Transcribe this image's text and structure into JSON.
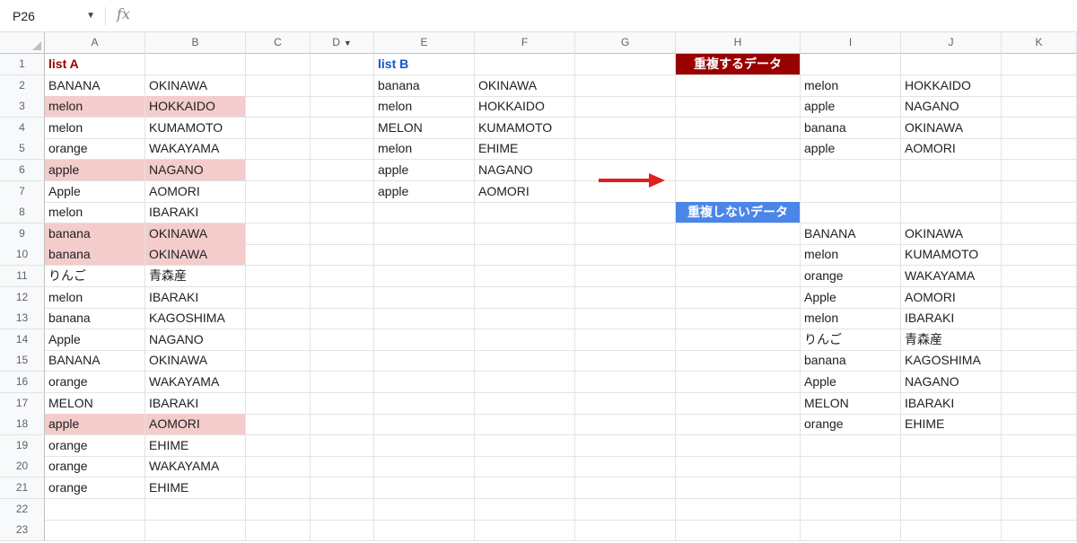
{
  "formula_bar": {
    "name_box": "P26",
    "fx_label": "fx"
  },
  "columns": [
    "A",
    "B",
    "C",
    "D",
    "E",
    "F",
    "G",
    "H",
    "I",
    "J",
    "K"
  ],
  "rows": [
    "1",
    "2",
    "3",
    "4",
    "5",
    "6",
    "7",
    "8",
    "9",
    "10",
    "11",
    "12",
    "13",
    "14",
    "15",
    "16",
    "17",
    "18",
    "19",
    "20",
    "21",
    "22",
    "23"
  ],
  "list_a": {
    "title": "list A",
    "rows": [
      [
        "BANANA",
        "OKINAWA"
      ],
      [
        "melon",
        "HOKKAIDO"
      ],
      [
        "melon",
        "KUMAMOTO"
      ],
      [
        "orange",
        "WAKAYAMA"
      ],
      [
        "apple",
        "NAGANO"
      ],
      [
        "Apple",
        "AOMORI"
      ],
      [
        "melon",
        "IBARAKI"
      ],
      [
        "banana",
        "OKINAWA"
      ],
      [
        "banana",
        "OKINAWA"
      ],
      [
        "りんご",
        "青森産"
      ],
      [
        "melon",
        "IBARAKI"
      ],
      [
        "banana",
        "KAGOSHIMA"
      ],
      [
        "Apple",
        "NAGANO"
      ],
      [
        "BANANA",
        "OKINAWA"
      ],
      [
        "orange",
        "WAKAYAMA"
      ],
      [
        "MELON",
        "IBARAKI"
      ],
      [
        "apple",
        "AOMORI"
      ],
      [
        "orange",
        "EHIME"
      ],
      [
        "orange",
        "WAKAYAMA"
      ],
      [
        "orange",
        "EHIME"
      ]
    ],
    "highlight_color": "#f4cccc"
  },
  "list_b": {
    "title": "list B",
    "rows": [
      [
        "banana",
        "OKINAWA"
      ],
      [
        "melon",
        "HOKKAIDO"
      ],
      [
        "MELON",
        "KUMAMOTO"
      ],
      [
        "melon",
        "EHIME"
      ],
      [
        "apple",
        "NAGANO"
      ],
      [
        "apple",
        "AOMORI"
      ]
    ]
  },
  "dup_label": "重複するデータ",
  "dup_color": "#990000",
  "duplicates": [
    [
      "melon",
      "HOKKAIDO"
    ],
    [
      "apple",
      "NAGANO"
    ],
    [
      "banana",
      "OKINAWA"
    ],
    [
      "apple",
      "AOMORI"
    ]
  ],
  "nodup_label": "重複しないデータ",
  "nodup_color": "#4a86e8",
  "non_duplicates": [
    [
      "BANANA",
      "OKINAWA"
    ],
    [
      "melon",
      "KUMAMOTO"
    ],
    [
      "orange",
      "WAKAYAMA"
    ],
    [
      "Apple",
      "AOMORI"
    ],
    [
      "melon",
      "IBARAKI"
    ],
    [
      "りんご",
      "青森産"
    ],
    [
      "banana",
      "KAGOSHIMA"
    ],
    [
      "Apple",
      "NAGANO"
    ],
    [
      "MELON",
      "IBARAKI"
    ],
    [
      "orange",
      "EHIME"
    ]
  ],
  "arrow_color": "#e02020"
}
